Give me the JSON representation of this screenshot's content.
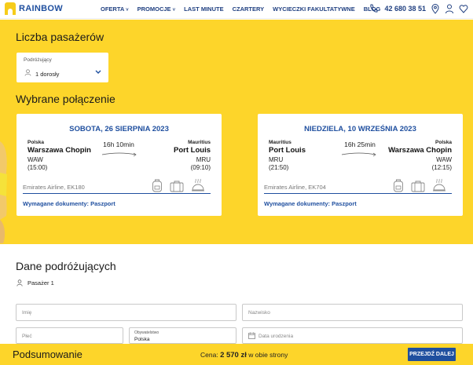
{
  "header": {
    "logo_text": "RAINBOW",
    "nav": [
      "OFERTA",
      "PROMOCJE",
      "LAST MINUTE",
      "CZARTERY",
      "WYCIECZKI FAKULTATYWNE",
      "BLOG"
    ],
    "phone": "42 680 38 51",
    "icons": [
      "phone-icon",
      "location-pin-icon",
      "user-icon",
      "heart-icon"
    ]
  },
  "passengers": {
    "title": "Liczba pasażerów",
    "field_label": "Podróżujący",
    "value": "1 dorosły"
  },
  "connection": {
    "title": "Wybrane połączenie",
    "flights": [
      {
        "date": "SOBOTA, 26 SIERPNIA 2023",
        "from_country": "Polska",
        "from_city": "Warszawa Chopin",
        "from_code": "WAW",
        "from_time": "(15:00)",
        "duration": "16h 10min",
        "to_country": "Mauritius",
        "to_city": "Port Louis",
        "to_code": "MRU",
        "to_time": "(09:10)",
        "airline": "Emirates Airline, EK180",
        "docs": "Wymagane dokumenty: Paszport"
      },
      {
        "date": "NIEDZIELA, 10 WRZEŚNIA 2023",
        "from_country": "Mauritius",
        "from_city": "Port Louis",
        "from_code": "MRU",
        "from_time": "(21:50)",
        "duration": "16h 25min",
        "to_country": "Polska",
        "to_city": "Warszawa Chopin",
        "to_code": "WAW",
        "to_time": "(12:15)",
        "airline": "Emirates Airline, EK704",
        "docs": "Wymagane dokumenty: Paszport"
      }
    ]
  },
  "form": {
    "title": "Dane podróżujących",
    "passenger_label": "Pasażer 1",
    "first_name_placeholder": "Imię",
    "last_name_placeholder": "Nazwisko",
    "gender_placeholder": "Płeć",
    "citizenship_label": "Obywatelstwo",
    "citizenship_value": "Polska",
    "birth_date_placeholder": "Data urodzenia"
  },
  "summary": {
    "title": "Podsumowanie",
    "price_prefix": "Cena:",
    "price": "2 570 zł",
    "price_suffix": "w obie strony",
    "next_button": "PRZEJDŹ DALEJ"
  },
  "colors": {
    "brand_yellow": "#fdd52a",
    "brand_blue": "#1f4f9f"
  }
}
